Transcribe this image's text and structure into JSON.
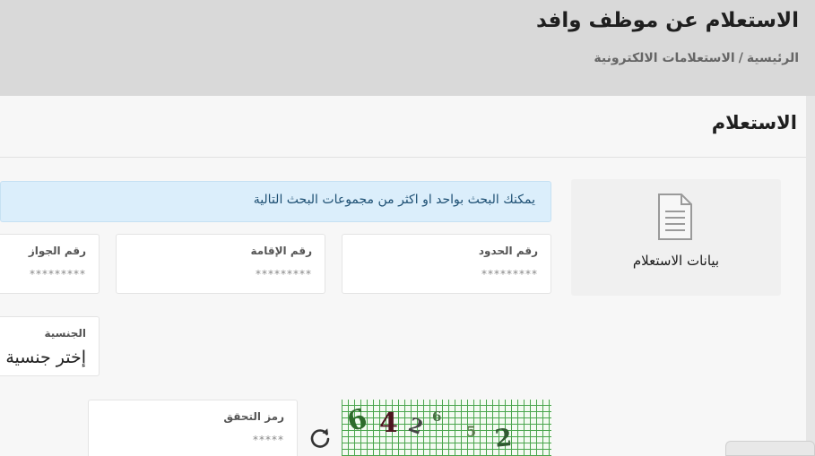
{
  "header": {
    "title": "الاستعلام عن موظف وافد",
    "breadcrumb": {
      "home": "الرئيسية",
      "separator": "/",
      "current": "الاستعلامات الالكترونية"
    }
  },
  "card": {
    "title": "الاستعلام",
    "side_tile": {
      "icon": "document-icon",
      "label": "بيانات الاستعلام"
    },
    "info_message": "يمكنك البحث بواحد او اكثر من مجموعات البحث التالية",
    "fields": {
      "border_number": {
        "label": "رقم الحدود",
        "placeholder": "*********"
      },
      "iqama_number": {
        "label": "رقم الإقامة",
        "placeholder": "*********"
      },
      "passport_number": {
        "label": "رقم الجواز",
        "placeholder": "*********"
      },
      "nationality": {
        "label": "الجنسية",
        "selected": "إختر جنسية"
      },
      "captcha_code": {
        "label": "رمز التحقق",
        "placeholder": "*****"
      }
    },
    "captcha": {
      "characters": [
        "6",
        "4",
        "2",
        "6",
        "5",
        "2"
      ],
      "refresh_icon": "refresh-icon"
    }
  },
  "colors": {
    "header_bg": "#d9d9d9",
    "card_bg": "#f7f7f7",
    "info_bg": "#dbeefb",
    "info_text": "#1d4f73",
    "captcha_grid": "#49a54c"
  }
}
